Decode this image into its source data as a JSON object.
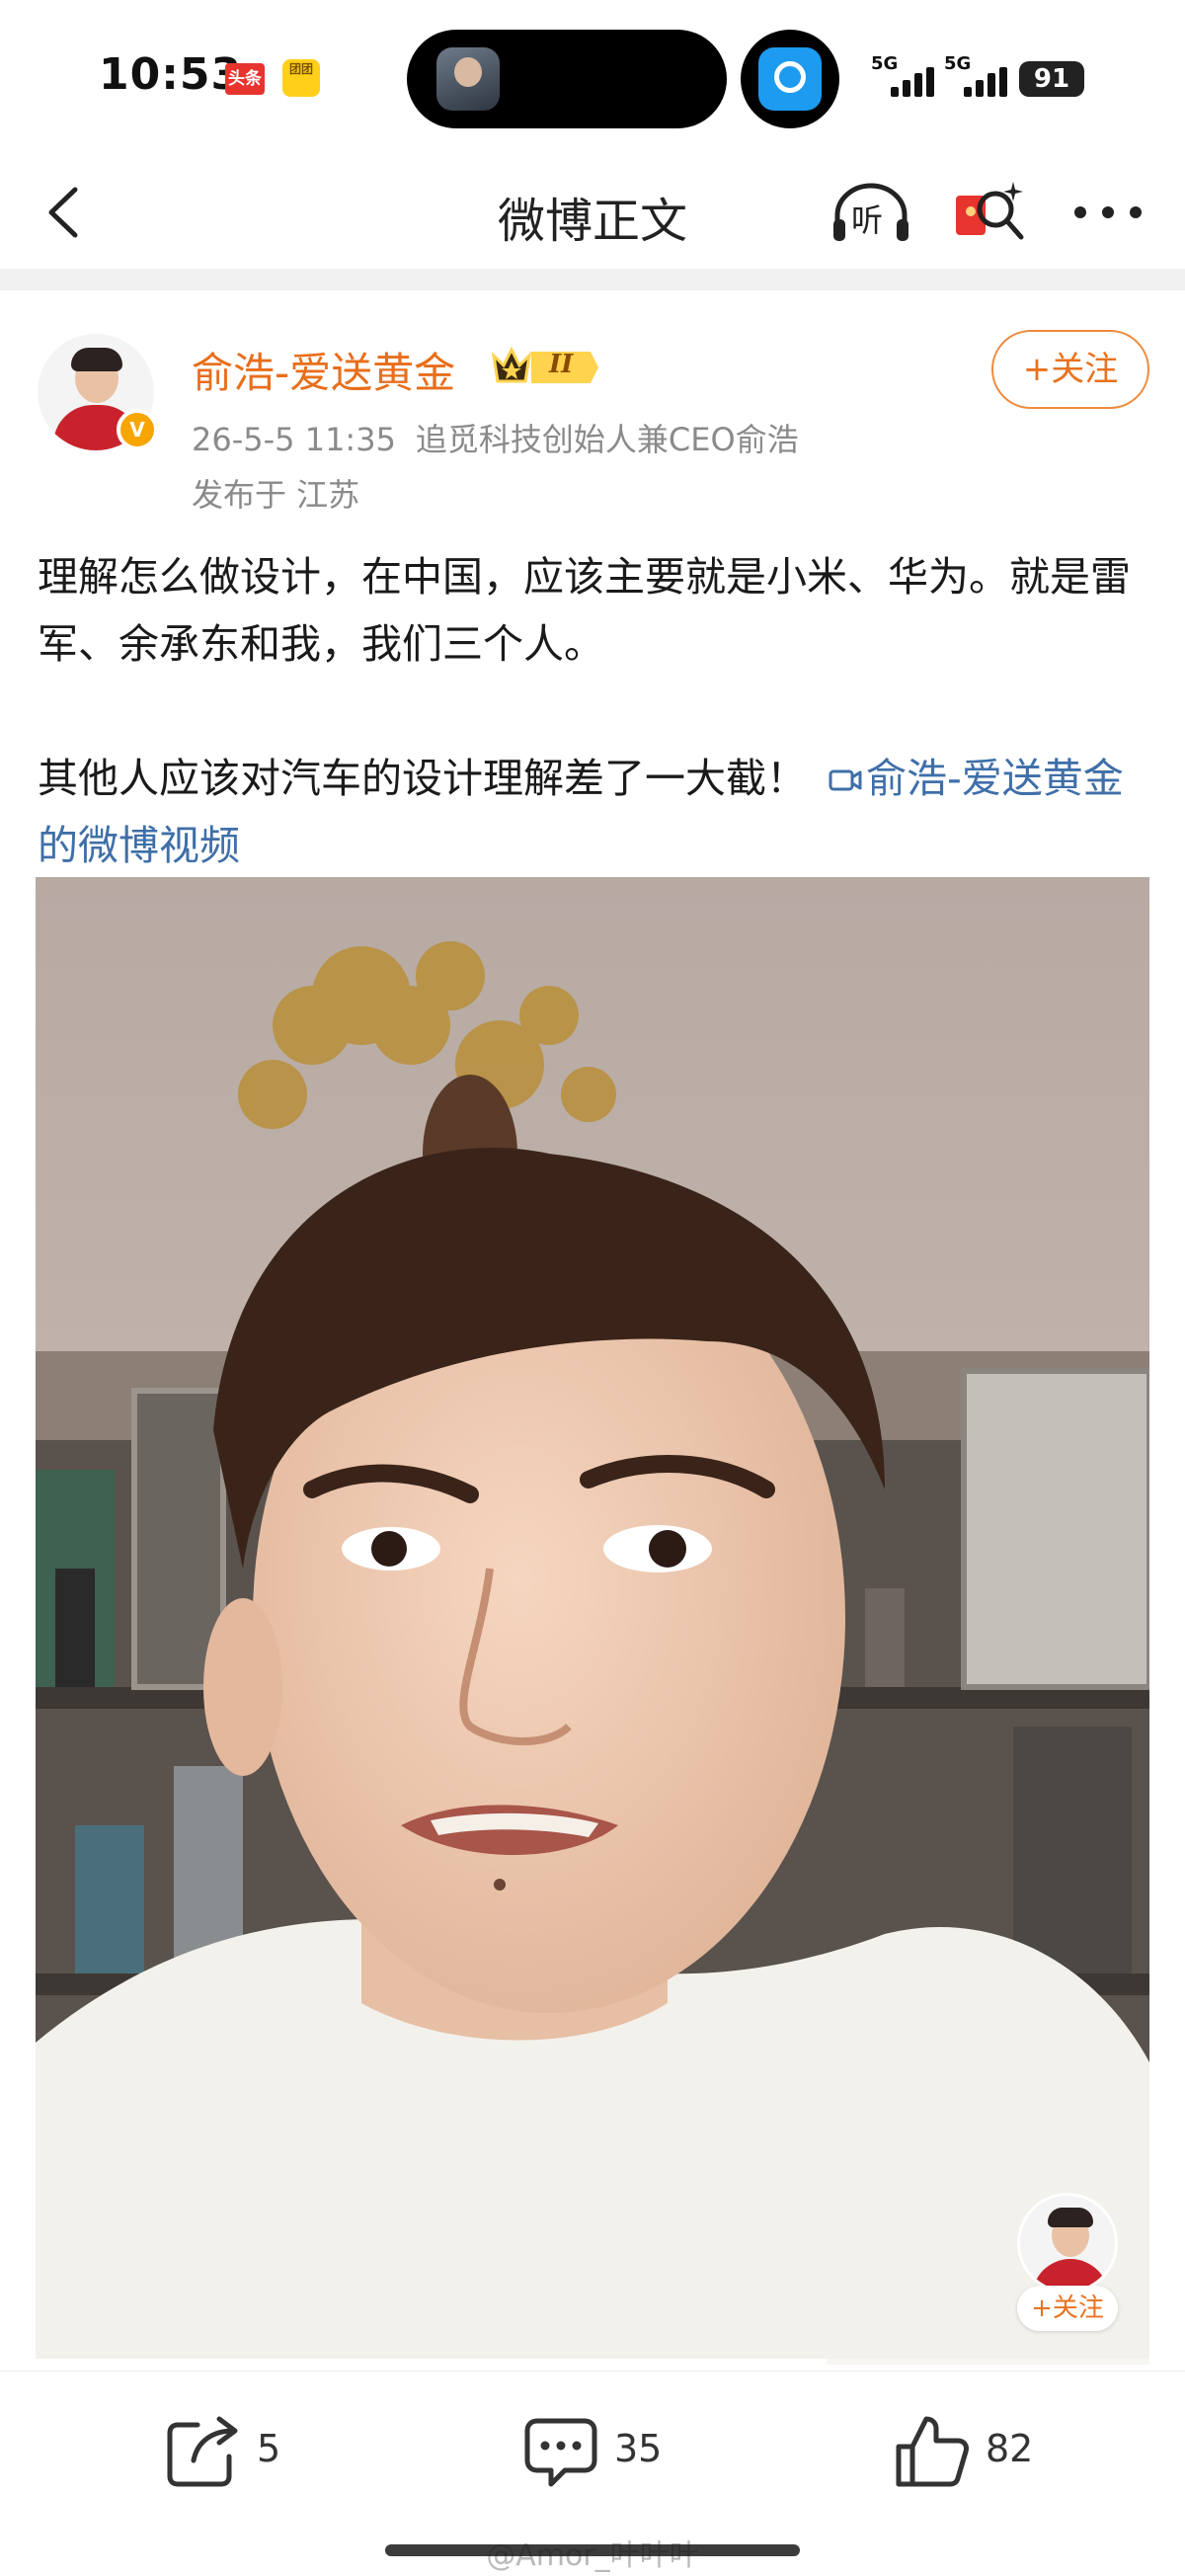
{
  "status_bar": {
    "time": "10:53",
    "badge_toutiao": "头条",
    "badge_tuan": "团团",
    "network_1": "5G",
    "network_2": "5G",
    "battery": "91"
  },
  "nav": {
    "title": "微博正文",
    "listen_label": "听"
  },
  "author": {
    "name": "俞浩-爱送黄金",
    "level_badge": "II",
    "verified_mark": "V",
    "follow_label": "+关注"
  },
  "post": {
    "timestamp": "26-5-5 11:35",
    "source": "追觅科技创始人兼CEO俞浩",
    "location": "发布于 江苏",
    "paragraph_1": "理解怎么做设计，在中国，应该主要就是小米、华为。就是雷军、余承东和我，我们三个人。",
    "paragraph_2": "其他人应该对汽车的设计理解差了一大截！",
    "video_link": "俞浩-爱送黄金的微博视频"
  },
  "video": {
    "progress": 0.71,
    "float_follow_label": "+关注"
  },
  "actions": {
    "repost_count": "5",
    "comment_count": "35",
    "like_count": "82"
  },
  "watermark": "@Amor_叶叶叶",
  "colors": {
    "accent_orange": "#e86e1b",
    "link_blue": "#3f6fa8",
    "meta_gray": "#8a8a8a"
  }
}
